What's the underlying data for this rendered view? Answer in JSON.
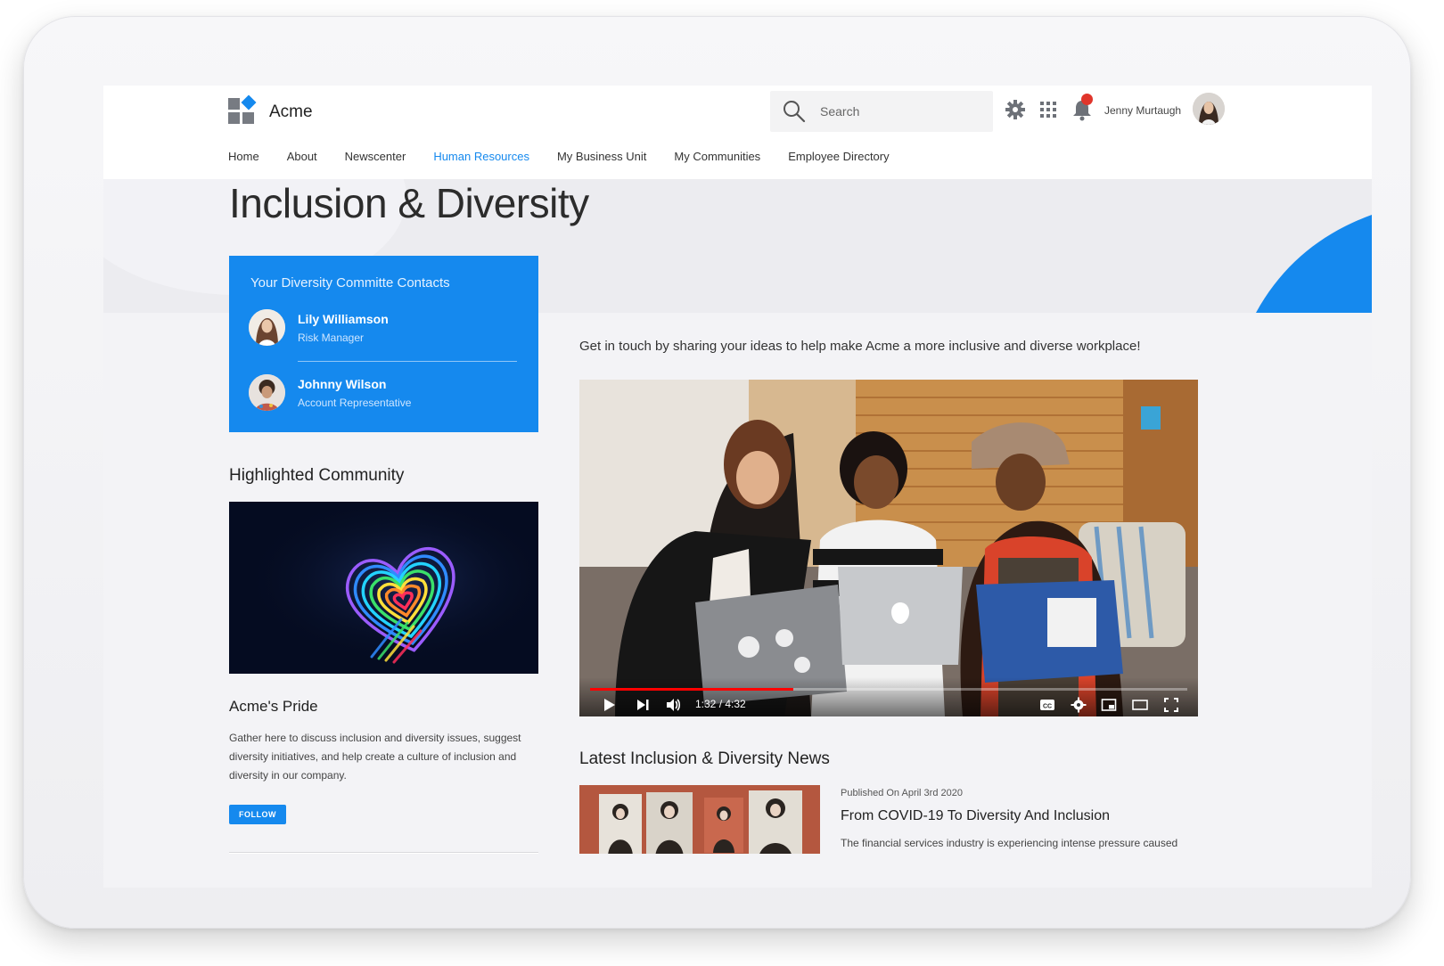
{
  "app": {
    "name": "Acme"
  },
  "header": {
    "search_placeholder": "Search",
    "user_name": "Jenny Murtaugh"
  },
  "nav": {
    "items": [
      {
        "label": "Home",
        "active": false
      },
      {
        "label": "About",
        "active": false
      },
      {
        "label": "Newscenter",
        "active": false
      },
      {
        "label": "Human Resources",
        "active": true
      },
      {
        "label": "My Business Unit",
        "active": false
      },
      {
        "label": "My Communities",
        "active": false
      },
      {
        "label": "Employee Directory",
        "active": false
      }
    ]
  },
  "page": {
    "title": "Inclusion & Diversity"
  },
  "contacts": {
    "title": "Your Diversity Committe Contacts",
    "people": [
      {
        "name": "Lily Williamson",
        "role": "Risk Manager"
      },
      {
        "name": "Johnny Wilson",
        "role": "Account Representative"
      }
    ]
  },
  "community": {
    "heading": "Highlighted Community",
    "name": "Acme's Pride",
    "description": "Gather here to discuss inclusion and diversity issues, suggest diversity initiatives, and help create a culture of inclusion and diversity in our company.",
    "follow_label": "FOLLOW"
  },
  "main": {
    "intro": "Get in touch by sharing your ideas to help make Acme a more inclusive and diverse workplace!"
  },
  "video": {
    "time_display": "1:32 / 4:32",
    "progress": 0.34,
    "cc_label": "CC"
  },
  "news": {
    "heading": "Latest Inclusion & Diversity News",
    "items": [
      {
        "meta": "Published On April 3rd 2020",
        "title": "From COVID-19 To Diversity And Inclusion",
        "excerpt": "The financial services industry is experiencing intense pressure caused"
      }
    ]
  },
  "colors": {
    "accent": "#1589ee",
    "progress": "#ff0000",
    "notification": "#e0352b"
  },
  "icons": [
    "search-icon",
    "gear-icon",
    "app-grid-icon",
    "bell-icon",
    "play-icon",
    "next-icon",
    "volume-icon",
    "captions-icon",
    "settings-icon",
    "miniplayer-icon",
    "theater-icon",
    "fullscreen-icon"
  ]
}
